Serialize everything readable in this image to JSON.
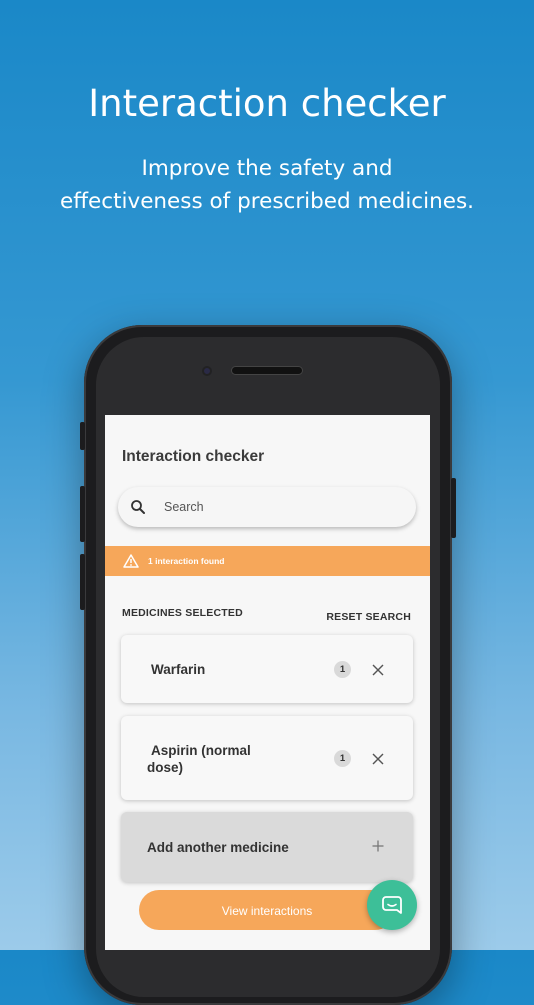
{
  "promo": {
    "headline": "Interaction checker",
    "subline_1": "Improve the safety and",
    "subline_2": "effectiveness of prescribed medicines."
  },
  "app": {
    "title": "Interaction checker",
    "search": {
      "placeholder": "Search",
      "value": ""
    },
    "alert": {
      "text": "1 interaction found",
      "color": "#f6a75a"
    },
    "section_label": "MEDICINES SELECTED",
    "reset_label": "RESET SEARCH",
    "medicines": [
      {
        "name": "Warfarin",
        "interactions": "1"
      },
      {
        "name_line1": "Aspirin (normal",
        "name_line2": "dose)",
        "interactions": "1"
      }
    ],
    "add_label": "Add another medicine",
    "view_button": "View interactions",
    "chat_icon": "chat-bubble-icon"
  },
  "colors": {
    "accent": "#f6a75a",
    "chat": "#3dbf98",
    "background_top": "#1a88c8",
    "background_bottom": "#9ccbea"
  }
}
